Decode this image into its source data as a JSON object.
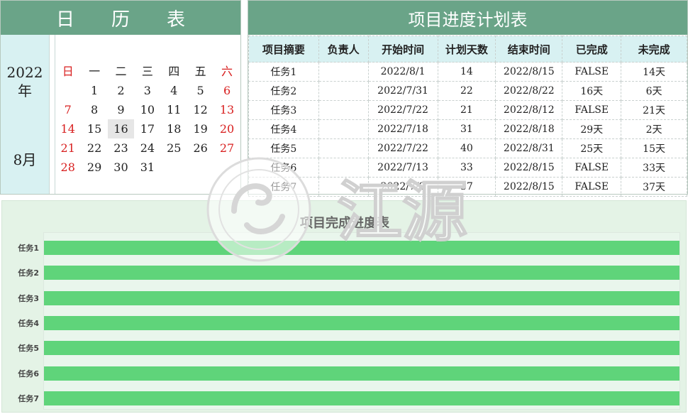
{
  "calendar": {
    "title": "日　　历　　表",
    "year": "2022\n年",
    "month": "8月",
    "weekdays": [
      "日",
      "一",
      "二",
      "三",
      "四",
      "五",
      "六"
    ],
    "weeks": [
      [
        "",
        "1",
        "2",
        "3",
        "4",
        "5",
        "6"
      ],
      [
        "7",
        "8",
        "9",
        "10",
        "11",
        "12",
        "13"
      ],
      [
        "14",
        "15",
        "16",
        "17",
        "18",
        "19",
        "20"
      ],
      [
        "21",
        "22",
        "23",
        "24",
        "25",
        "26",
        "27"
      ],
      [
        "28",
        "29",
        "30",
        "31",
        "",
        "",
        ""
      ]
    ],
    "today": "16",
    "weekend_color": "#d81e1e"
  },
  "schedule": {
    "title": "项目进度计划表",
    "headers": [
      "项目摘要",
      "负责人",
      "开始时间",
      "计划天数",
      "结束时间",
      "已完成",
      "未完成"
    ],
    "rows": [
      [
        "任务1",
        "",
        "2022/8/1",
        "14",
        "2022/8/15",
        "FALSE",
        "14天"
      ],
      [
        "任务2",
        "",
        "2022/7/31",
        "22",
        "2022/8/22",
        "16天",
        "6天"
      ],
      [
        "任务3",
        "",
        "2022/7/22",
        "21",
        "2022/8/12",
        "FALSE",
        "21天"
      ],
      [
        "任务4",
        "",
        "2022/7/18",
        "31",
        "2022/8/18",
        "29天",
        "2天"
      ],
      [
        "任务5",
        "",
        "2022/7/22",
        "40",
        "2022/8/31",
        "25天",
        "15天"
      ],
      [
        "任务6",
        "",
        "2022/7/13",
        "33",
        "2022/8/15",
        "FALSE",
        "33天"
      ],
      [
        "任务7",
        "",
        "2022/7/9",
        "37",
        "2022/8/15",
        "FALSE",
        "37天"
      ]
    ]
  },
  "chart_data": {
    "type": "bar",
    "orientation": "horizontal",
    "title": "项目完成进度表",
    "categories": [
      "任务1",
      "任务2",
      "任务3",
      "任务4",
      "任务5",
      "任务6",
      "任务7"
    ],
    "values": [
      1,
      1,
      1,
      1,
      1,
      1,
      1
    ],
    "xlim": [
      0,
      1
    ],
    "bar_color": "#5fd47a"
  },
  "watermark": {
    "text": "江源"
  },
  "colors": {
    "header_green": "#6aa488",
    "header_cyan": "#d8f1f2"
  }
}
